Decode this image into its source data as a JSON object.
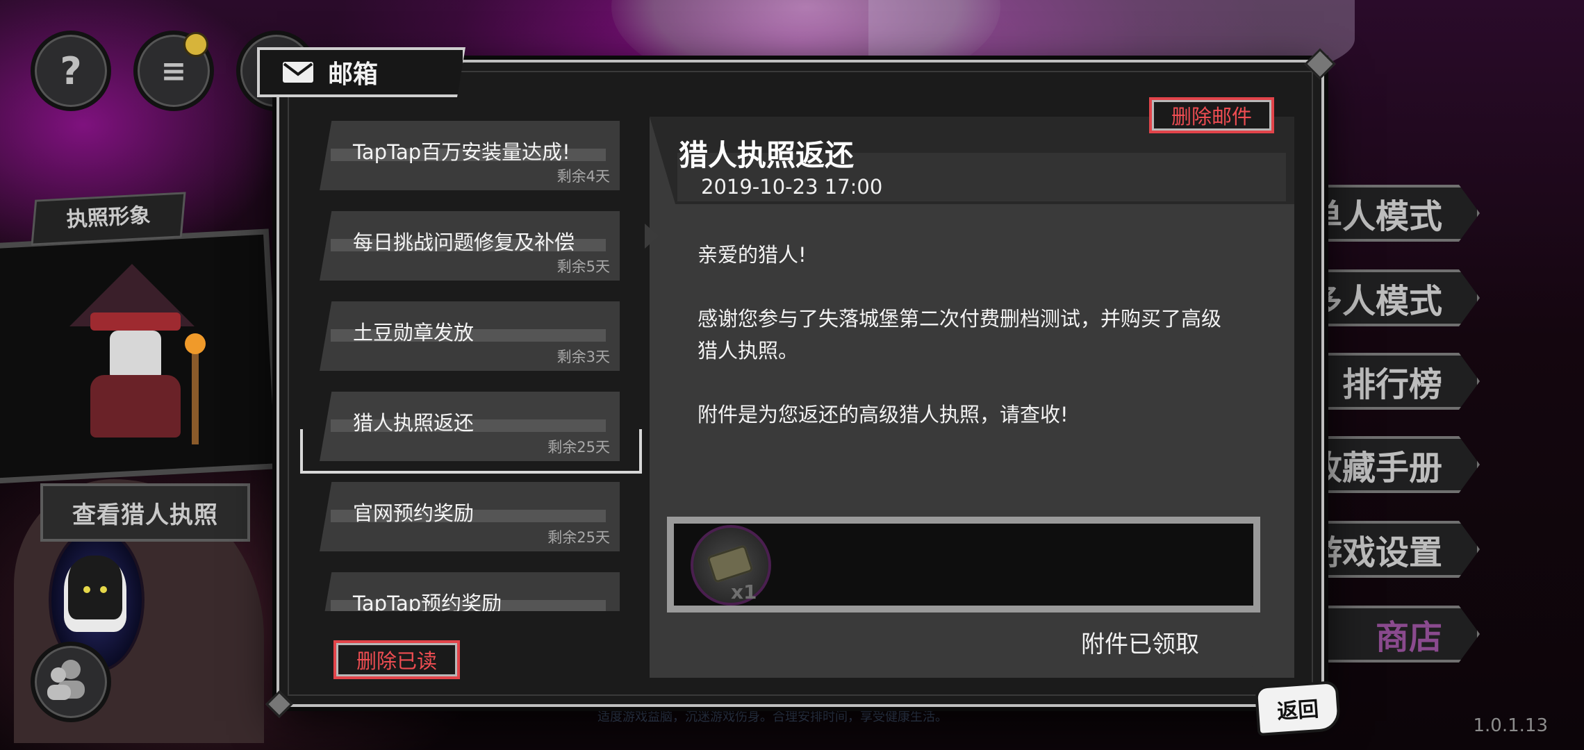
{
  "dialog": {
    "title": "邮箱",
    "icon": "mail-icon",
    "delete_read_label": "删除已读",
    "delete_mail_label": "删除邮件"
  },
  "mails": [
    {
      "title": "TapTap百万安装量达成!",
      "remaining": "剩余4天",
      "selected": false
    },
    {
      "title": "每日挑战问题修复及补偿",
      "remaining": "剩余5天",
      "selected": false
    },
    {
      "title": "土豆勋章发放",
      "remaining": "剩余3天",
      "selected": false
    },
    {
      "title": "猎人执照返还",
      "remaining": "剩余25天",
      "selected": true
    },
    {
      "title": "官网预约奖励",
      "remaining": "剩余25天",
      "selected": false
    },
    {
      "title": "TapTap预约奖励",
      "remaining": "",
      "selected": false
    }
  ],
  "detail": {
    "title": "猎人执照返还",
    "date": "2019-10-23 17:00",
    "body": "亲爱的猎人!\n\n感谢您参与了失落城堡第二次付费删档测试，并购买了高级\n猎人执照。\n\n附件是为您返还的高级猎人执照，请查收!",
    "attachment_qty": "x1",
    "attachment_status": "附件已领取"
  },
  "left_panel": {
    "license_tag": "执照形象",
    "view_license_label": "查看猎人执照"
  },
  "right_menu": [
    {
      "label": "单人模式"
    },
    {
      "label": "多人模式"
    },
    {
      "label": "排行榜"
    },
    {
      "label": "收藏手册"
    },
    {
      "label": "游戏设置"
    },
    {
      "label": "商店"
    }
  ],
  "back_label": "返回",
  "version": "1.0.1.13",
  "footer_tip": "适度游戏益脑，沉迷游戏伤身。合理安排时间，享受健康生活。",
  "colors": {
    "accent_red": "#e2444a",
    "panel_dark": "#1b1b1b",
    "panel_mid": "#3a3a3a"
  }
}
